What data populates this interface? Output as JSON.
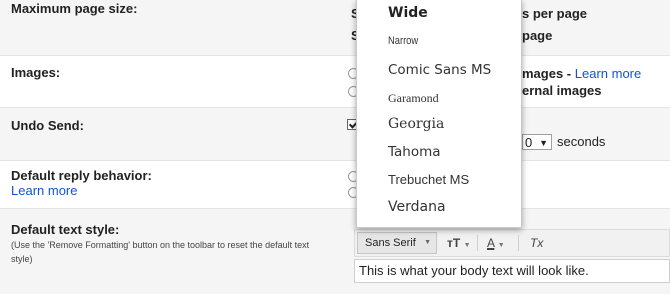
{
  "settings": {
    "max_page_size": {
      "label": "Maximum page size:",
      "line1_prefix": "S",
      "line1_suffix": "s per page",
      "line2_prefix": "S",
      "line2_suffix": "page"
    },
    "images": {
      "label": "Images:",
      "opt1_text": "mages - ",
      "opt1_link": "Learn more",
      "opt2_text": "ernal images"
    },
    "undo_send": {
      "label": "Undo Send:",
      "seconds_value": "0",
      "seconds_label": "seconds"
    },
    "reply_behavior": {
      "label": "Default reply behavior:",
      "link": "Learn more"
    },
    "text_style": {
      "label": "Default text style:",
      "help": "(Use the 'Remove Formatting' button on the toolbar to reset the default text style)",
      "font_button": "Sans Serif",
      "size_icon_text": "тT",
      "color_icon_text": "A",
      "clear_icon_text": "Tx",
      "preview": "This is what your body text will look like."
    }
  },
  "font_menu": {
    "items": [
      "Wide",
      "Narrow",
      "Comic Sans MS",
      "Garamond",
      "Georgia",
      "Tahoma",
      "Trebuchet MS",
      "Verdana"
    ]
  },
  "colors": {
    "link": "#1155cc",
    "row_alt": "#f5f5f5",
    "divider": "#e5e5e5"
  }
}
